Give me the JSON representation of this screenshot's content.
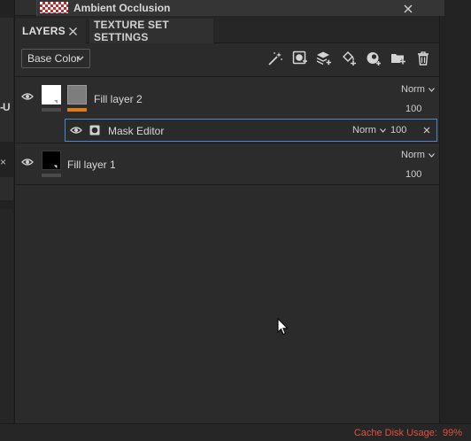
{
  "left_panel": {
    "fragment_text": "-U",
    "close_glyph": "×"
  },
  "top_window": {
    "title": "Ambient Occlusion",
    "thumbnail": "ao-checker-thumbnail",
    "close_icon": "close-icon"
  },
  "tabs": [
    {
      "label": "LAYERS",
      "active": true,
      "closable": true
    },
    {
      "label": "TEXTURE SET SETTINGS",
      "active": false,
      "closable": false
    }
  ],
  "toolbar": {
    "channel_select": {
      "value": "Base Color"
    },
    "tools": [
      "add-effect-icon",
      "add-mask-icon",
      "add-layer-icon",
      "add-fill-layer-icon",
      "add-smart-material-icon",
      "add-folder-icon",
      "delete-icon"
    ]
  },
  "layers": [
    {
      "name": "Fill layer 2",
      "blend_mode": "Norm",
      "opacity": "100",
      "mask": {
        "name": "Mask Editor",
        "blend_mode": "Norm",
        "opacity": "100"
      }
    },
    {
      "name": "Fill layer 1",
      "blend_mode": "Norm",
      "opacity": "100"
    }
  ],
  "status_bar": {
    "label": "Cache Disk Usage:",
    "value": "99%"
  },
  "colors": {
    "panel_bg": "#2b2b2b",
    "selection_border": "#4a86c8",
    "mask_bar": "#e07a1f",
    "status_warning": "#e05040"
  }
}
